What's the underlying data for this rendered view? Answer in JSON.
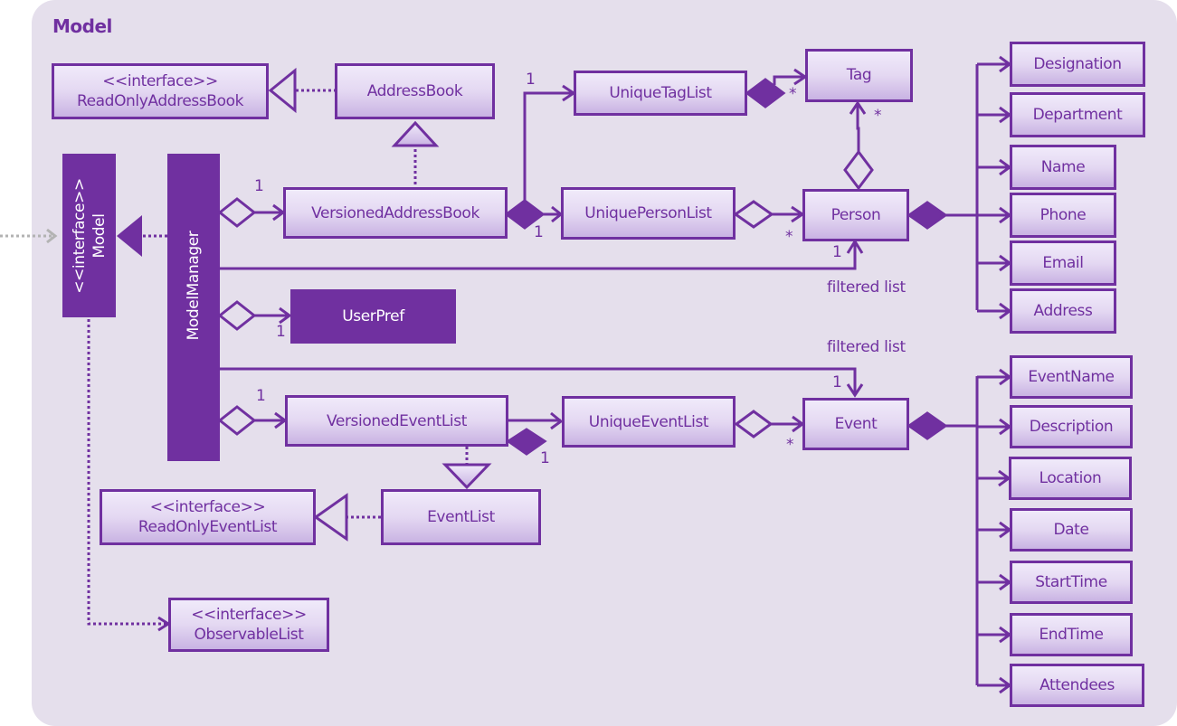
{
  "diagram": {
    "title": "Model",
    "accent_color": "#7030a0",
    "panel_color": "#e5dfec",
    "interface_stereotype": "<<interface>>",
    "classes": {
      "read_only_address_book": "ReadOnlyAddressBook",
      "address_book": "AddressBook",
      "unique_tag_list": "UniqueTagList",
      "tag": "Tag",
      "model": "Model",
      "model_manager": "ModelManager",
      "versioned_address_book": "VersionedAddressBook",
      "unique_person_list": "UniquePersonList",
      "person": "Person",
      "user_pref": "UserPref",
      "versioned_event_list": "VersionedEventList",
      "unique_event_list": "UniqueEventList",
      "event": "Event",
      "read_only_event_list": "ReadOnlyEventList",
      "event_list": "EventList",
      "observable_list": "ObservableList"
    },
    "person_attributes": [
      "Designation",
      "Department",
      "Name",
      "Phone",
      "Email",
      "Address"
    ],
    "event_attributes": [
      "EventName",
      "Description",
      "Location",
      "Date",
      "StartTime",
      "EndTime",
      "Attendees"
    ],
    "labels": {
      "filtered_list_person": "filtered list",
      "filtered_list_event": "filtered list"
    },
    "multiplicities": {
      "mm_vab": "1",
      "vab_utl": "1",
      "vab_upl": "1",
      "utl_tag": "*",
      "person_tag": "*",
      "upl_person": "*",
      "mm_person": "1",
      "mm_userpref": "1",
      "mm_event": "1",
      "mm_vel": "1",
      "vel_uel": "1",
      "uel_event": "*"
    }
  }
}
